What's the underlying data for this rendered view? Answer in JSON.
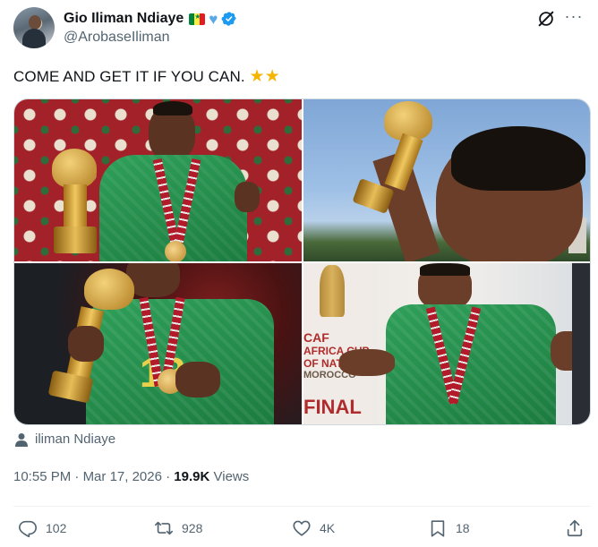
{
  "user": {
    "display_name": "Gio Iliman Ndiaye",
    "handle": "@ArobaseIliman",
    "verified": true,
    "name_emojis": [
      "senegal-flag",
      "blue-heart"
    ]
  },
  "tweet": {
    "text": "COME AND GET IT IF YOU CAN.",
    "trailing_emojis": [
      "star",
      "star"
    ]
  },
  "media": {
    "tiles": [
      {
        "name": "trophy-red-background"
      },
      {
        "name": "trophy-sky"
      },
      {
        "name": "trophy-medal-kiss"
      },
      {
        "name": "trophy-afcon-backdrop",
        "poster_lines": [
          "CAF",
          "AFRICA CUP",
          "OF NATIONS",
          "MOROCCO",
          "FINAL"
        ]
      }
    ],
    "photo_credit": "iliman Ndiaye"
  },
  "meta": {
    "time": "10:55 PM",
    "separator": "·",
    "date": "Mar 17, 2026",
    "views_count": "19.9K",
    "views_label": "Views"
  },
  "actions": {
    "replies": "102",
    "reposts": "928",
    "likes": "4K",
    "bookmarks": "18"
  },
  "colors": {
    "text_primary": "#0f1419",
    "text_secondary": "#536471",
    "verified_blue": "#1d9bf0",
    "border": "#cfd9de"
  }
}
